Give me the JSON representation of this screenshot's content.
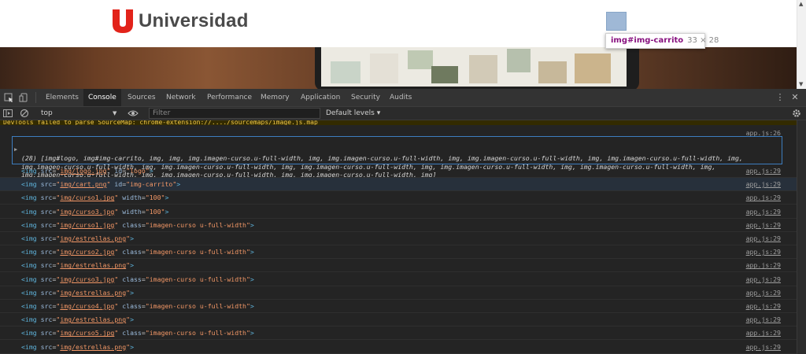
{
  "website": {
    "logo_text": "Universidad",
    "logo_mark": "U",
    "tooltip": {
      "selector": "img#img-carrito",
      "size": "33 × 28"
    }
  },
  "devtools": {
    "tabs": [
      {
        "label": "Elements"
      },
      {
        "label": "Console",
        "active": true
      },
      {
        "label": "Sources"
      },
      {
        "label": "Network"
      },
      {
        "label": "Performance"
      },
      {
        "label": "Memory"
      },
      {
        "label": "Application"
      },
      {
        "label": "Security"
      },
      {
        "label": "Audits"
      }
    ],
    "context": "top",
    "filter_placeholder": "Filter",
    "levels": "Default levels ▾",
    "warning": "DevTools failed to parse SourceMap: chrome-extension://..../sourcemaps/image.js.map",
    "array_source": "app.js:26",
    "array_lines": [
      "(28) [img#logo, img#img-carrito, img, img, img.imagen-curso.u-full-width, img, img.imagen-curso.u-full-width, img, img.imagen-curso.u-full-width, img, img.imagen-curso.u-full-width, img,",
      "img.imagen-curso.u-full-width, img, img.imagen-curso.u-full-width, img, img.imagen-curso.u-full-width, img, img.imagen-curso.u-full-width, img, img.imagen-curso.u-full-width, img,",
      "img.imagen-curso.u-full-width, img, img.imagen-curso.u-full-width, img, img.imagen-curso.u-full-width, img]"
    ],
    "rows": [
      {
        "src": "img/logo.jpg",
        "attr": "id",
        "val": "logo",
        "source": "app.js:29"
      },
      {
        "src": "img/cart.png",
        "attr": "id",
        "val": "img-carrito",
        "source": "app.js:29",
        "highlight": true
      },
      {
        "src": "img/curso1.jpg",
        "attr": "width",
        "val": "100",
        "source": "app.js:29"
      },
      {
        "src": "img/curso3.jpg",
        "attr": "width",
        "val": "100",
        "source": "app.js:29"
      },
      {
        "src": "img/curso1.jpg",
        "attr": "class",
        "val": "imagen-curso u-full-width",
        "source": "app.js:29"
      },
      {
        "src": "img/estrellas.png",
        "attr": "",
        "val": "",
        "source": "app.js:29"
      },
      {
        "src": "img/curso2.jpg",
        "attr": "class",
        "val": "imagen-curso u-full-width",
        "source": "app.js:29"
      },
      {
        "src": "img/estrellas.png",
        "attr": "",
        "val": "",
        "source": "app.js:29"
      },
      {
        "src": "img/curso3.jpg",
        "attr": "class",
        "val": "imagen-curso u-full-width",
        "source": "app.js:29"
      },
      {
        "src": "img/estrellas.png",
        "attr": "",
        "val": "",
        "source": "app.js:29"
      },
      {
        "src": "img/curso4.jpg",
        "attr": "class",
        "val": "imagen-curso u-full-width",
        "source": "app.js:29"
      },
      {
        "src": "img/estrellas.png",
        "attr": "",
        "val": "",
        "source": "app.js:29"
      },
      {
        "src": "img/curso5.jpg",
        "attr": "class",
        "val": "imagen-curso u-full-width",
        "source": "app.js:29"
      },
      {
        "src": "img/estrellas.png",
        "attr": "",
        "val": "",
        "source": "app.js:29"
      }
    ]
  },
  "colors": {
    "brand_red": "#e2231a",
    "devtools_bg": "#242424",
    "tag": "#5db0d7",
    "attr_value": "#f29766",
    "selection_border": "#3d7dbf"
  }
}
